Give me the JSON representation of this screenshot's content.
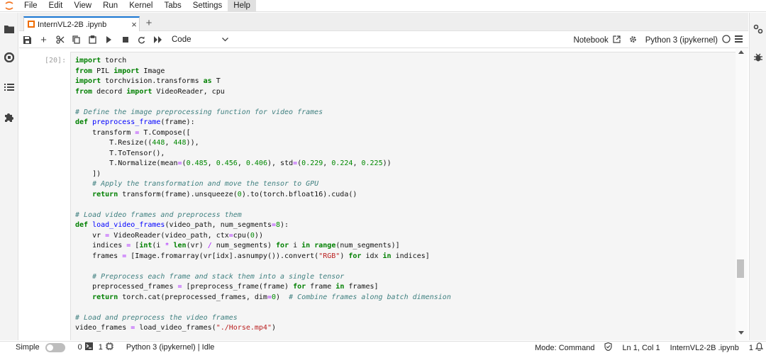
{
  "menu": [
    "File",
    "Edit",
    "View",
    "Run",
    "Kernel",
    "Tabs",
    "Settings",
    "Help"
  ],
  "tab": {
    "title": "InternVL2-2B .ipynb"
  },
  "toolbar": {
    "cell_type": "Code",
    "notebook_link": "Notebook",
    "kernel_name": "Python 3 (ipykernel)"
  },
  "cell": {
    "prompt": "[20]:",
    "lines": [
      "import torch",
      "from PIL import Image",
      "import torchvision.transforms as T",
      "from decord import VideoReader, cpu",
      "",
      "# Define the image preprocessing function for video frames",
      "def preprocess_frame(frame):",
      "    transform = T.Compose([",
      "        T.Resize((448, 448)),",
      "        T.ToTensor(),",
      "        T.Normalize(mean=(0.485, 0.456, 0.406), std=(0.229, 0.224, 0.225))",
      "    ])",
      "    # Apply the transformation and move the tensor to GPU",
      "    return transform(frame).unsqueeze(0).to(torch.bfloat16).cuda()",
      "",
      "# Load video frames and preprocess them",
      "def load_video_frames(video_path, num_segments=8):",
      "    vr = VideoReader(video_path, ctx=cpu(0))",
      "    indices = [int(i * len(vr) / num_segments) for i in range(num_segments)]",
      "    frames = [Image.fromarray(vr[idx].asnumpy()).convert(\"RGB\") for idx in indices]",
      "",
      "    # Preprocess each frame and stack them into a single tensor",
      "    preprocessed_frames = [preprocess_frame(frame) for frame in frames]",
      "    return torch.cat(preprocessed_frames, dim=0)  # Combine frames along batch dimension",
      "",
      "# Load and preprocess the video frames",
      "video_frames = load_video_frames(\"./Horse.mp4\")"
    ]
  },
  "status": {
    "mode_label": "Simple",
    "terminals": "0",
    "kernels": "1",
    "kernel_status": "Python 3 (ipykernel) | Idle",
    "mode": "Mode: Command",
    "position": "Ln 1, Col 1",
    "file": "InternVL2-2B .ipynb",
    "notifications": "1"
  }
}
